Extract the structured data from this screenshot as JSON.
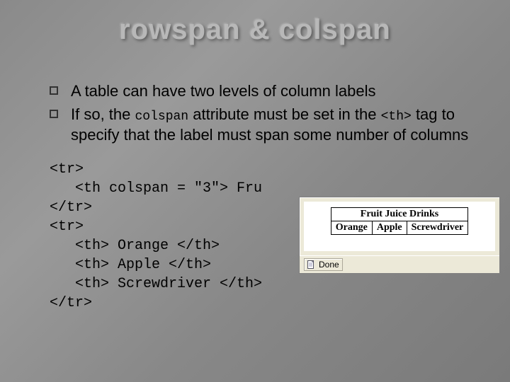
{
  "title": "rowspan & colspan",
  "bullets": [
    {
      "text": "A table can have two levels of column labels"
    },
    {
      "text_parts": [
        "If so, the ",
        "colspan",
        " attribute must be set in the ",
        "<th>",
        " tag to specify that the label must span some number of columns"
      ]
    }
  ],
  "code": "<tr>\n   <th colspan = \"3\"> Fru\n</tr>\n<tr>\n   <th> Orange </th>\n   <th> Apple </th>\n   <th> Screwdriver </th>\n</tr>",
  "example": {
    "header": "Fruit Juice Drinks",
    "cells": [
      "Orange",
      "Apple",
      "Screwdriver"
    ],
    "status": "Done"
  }
}
